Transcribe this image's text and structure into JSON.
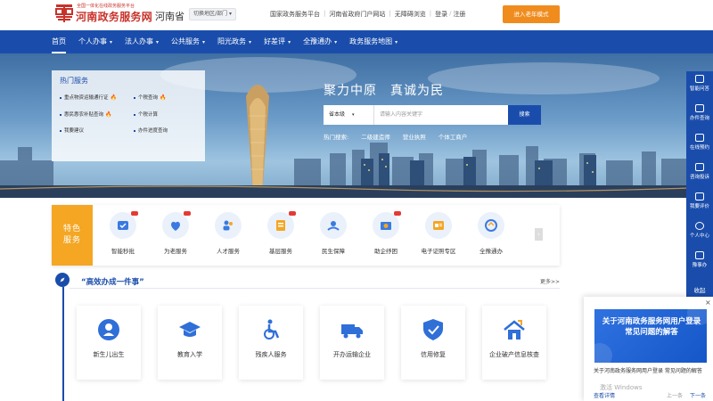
{
  "header": {
    "logo_small": "全国一体化在线政务服务平台",
    "logo_main": "河南政务服务网",
    "province": "河南省",
    "switch_region": "切换地区/部门",
    "links": [
      "国家政务服务平台",
      "河南省政府门户网站",
      "无障碍浏览",
      "登录",
      "注册"
    ],
    "elder_mode": "进入老年模式"
  },
  "nav": {
    "items": [
      {
        "label": "首页",
        "caret": false
      },
      {
        "label": "个人办事",
        "caret": true
      },
      {
        "label": "法人办事",
        "caret": true
      },
      {
        "label": "公共服务",
        "caret": true
      },
      {
        "label": "阳光政务",
        "caret": true
      },
      {
        "label": "好差评",
        "caret": true
      },
      {
        "label": "全豫通办",
        "caret": true
      },
      {
        "label": "政务服务地图",
        "caret": true
      }
    ]
  },
  "hot_services": {
    "title": "热门服务",
    "items": [
      {
        "label": "重点物资运输通行证",
        "hot": true
      },
      {
        "label": "个税查询",
        "hot": true
      },
      {
        "label": "惠民惠农补贴查询",
        "hot": true
      },
      {
        "label": "个税计算",
        "hot": false
      },
      {
        "label": "我要建议",
        "hot": false
      },
      {
        "label": "办件进度查询",
        "hot": false
      }
    ]
  },
  "hero": {
    "slogan": "聚力中原　真诚为民",
    "search_scope": "省本级",
    "search_placeholder": "请输入内容关键字",
    "search_button": "搜索",
    "hot_search_label": "热门搜索:",
    "hot_search_terms": [
      "二级建造师",
      "营业执照",
      "个体工商户"
    ]
  },
  "right_bar": {
    "items": [
      "智能问答",
      "办件查询",
      "在线预约",
      "咨询投诉",
      "我要评价",
      "个人中心",
      "豫事办",
      "收起"
    ]
  },
  "special_services": {
    "label_line1": "特色",
    "label_line2": "服务",
    "items": [
      "智能秒批",
      "为老服务",
      "人才服务",
      "基层服务",
      "民生保障",
      "助企纾困",
      "电子证照专区",
      "全豫通办"
    ],
    "next": "›"
  },
  "section": {
    "title": "“高效办成一件事”",
    "more": "更多>>"
  },
  "cards": {
    "items": [
      "新生儿出生",
      "教育入学",
      "残疾人服务",
      "开办运输企业",
      "信用修复",
      "企业破产信息核查"
    ]
  },
  "popup": {
    "close": "×",
    "banner_title": "关于河南政务服务网用户登录常见问题的解答",
    "text": "关于河南政务服务网用户登录 常见问题的解答",
    "watermark": "激活 Windows",
    "view_detail": "查看详情",
    "prev": "上一条",
    "next": "下一条"
  },
  "colors": {
    "brand_blue": "#1a4dab",
    "logo_red": "#c8322a",
    "elder_orange": "#f08c1e",
    "special_orange": "#f5a623"
  },
  "icons": {
    "hot": "fire-icon",
    "special": [
      "smart-approval-icon",
      "elder-service-icon",
      "talent-icon",
      "grassroots-icon",
      "livelihood-icon",
      "enterprise-relief-icon",
      "e-license-icon",
      "quanyu-icon"
    ],
    "cards": [
      "baby-icon",
      "graduation-cap-icon",
      "wheelchair-icon",
      "truck-icon",
      "shield-check-icon",
      "house-icon"
    ]
  }
}
